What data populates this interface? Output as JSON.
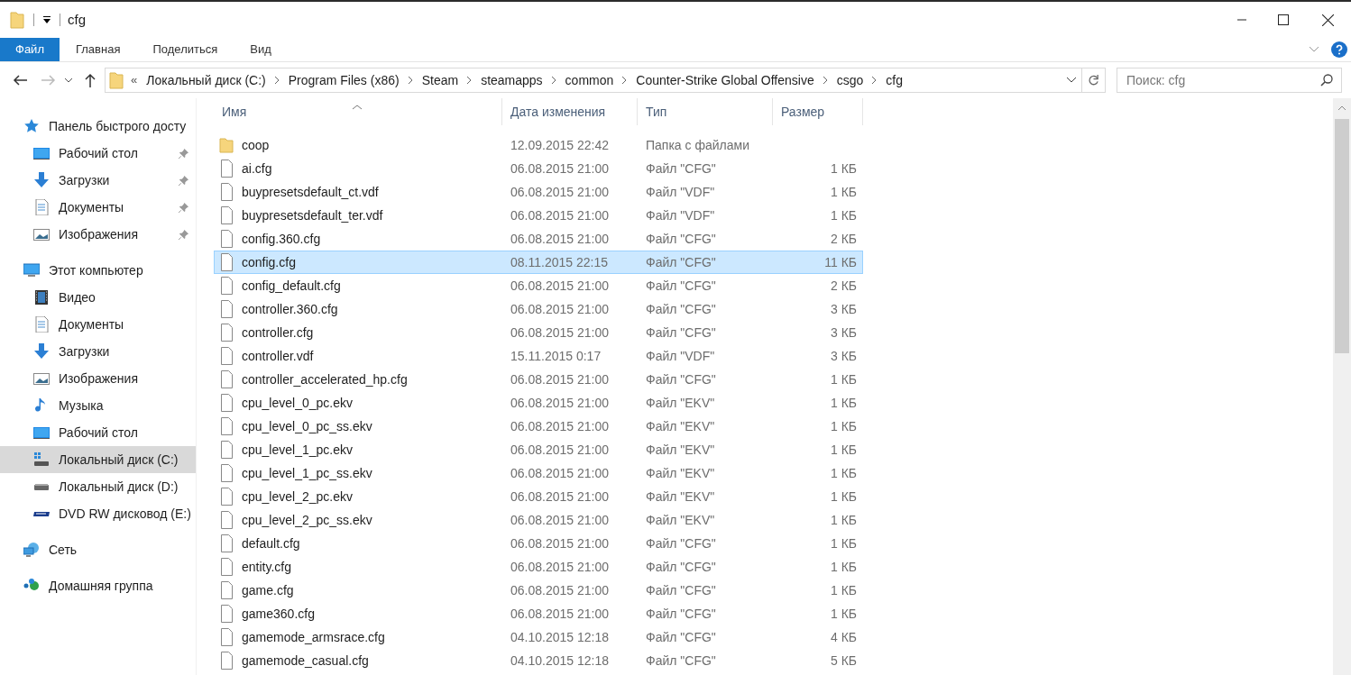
{
  "window": {
    "title": "cfg"
  },
  "ribbon_tabs": [
    {
      "label": "Файл",
      "selected": true
    },
    {
      "label": "Главная",
      "selected": false
    },
    {
      "label": "Поделиться",
      "selected": false
    },
    {
      "label": "Вид",
      "selected": false
    }
  ],
  "address_bar": {
    "overflow": "«",
    "path": [
      "Локальный диск (C:)",
      "Program Files (x86)",
      "Steam",
      "steamapps",
      "common",
      "Counter-Strike Global Offensive",
      "csgo",
      "cfg"
    ]
  },
  "search": {
    "placeholder": "Поиск: cfg"
  },
  "sidebar": {
    "items": [
      {
        "label": "Панель быстрого досту",
        "kind": "quick",
        "selected": false,
        "pinned": false,
        "children": [
          {
            "label": "Рабочий стол",
            "kind": "desktop",
            "selected": false,
            "pinned": true
          },
          {
            "label": "Загрузки",
            "kind": "downloads",
            "selected": false,
            "pinned": true
          },
          {
            "label": "Документы",
            "kind": "documents",
            "selected": false,
            "pinned": true
          },
          {
            "label": "Изображения",
            "kind": "pictures",
            "selected": false,
            "pinned": true
          }
        ]
      },
      {
        "label": "Этот компьютер",
        "kind": "computer",
        "selected": false,
        "pinned": false,
        "children": [
          {
            "label": "Видео",
            "kind": "video",
            "selected": false,
            "pinned": false
          },
          {
            "label": "Документы",
            "kind": "documents",
            "selected": false,
            "pinned": false
          },
          {
            "label": "Загрузки",
            "kind": "downloads",
            "selected": false,
            "pinned": false
          },
          {
            "label": "Изображения",
            "kind": "pictures",
            "selected": false,
            "pinned": false
          },
          {
            "label": "Музыка",
            "kind": "music",
            "selected": false,
            "pinned": false
          },
          {
            "label": "Рабочий стол",
            "kind": "desktop",
            "selected": false,
            "pinned": false
          },
          {
            "label": "Локальный диск (C:)",
            "kind": "system-drive",
            "selected": true,
            "pinned": false
          },
          {
            "label": "Локальный диск (D:)",
            "kind": "drive",
            "selected": false,
            "pinned": false
          },
          {
            "label": "DVD RW дисковод (E:)",
            "kind": "dvd",
            "selected": false,
            "pinned": false
          }
        ]
      },
      {
        "label": "Сеть",
        "kind": "network",
        "selected": false,
        "pinned": false
      },
      {
        "label": "Домашняя группа",
        "kind": "homegroup",
        "selected": false,
        "pinned": false
      }
    ]
  },
  "table": {
    "columns": [
      "Имя",
      "Дата изменения",
      "Тип",
      "Размер"
    ],
    "rows": [
      {
        "kind": "folder",
        "name": "coop",
        "date": "12.09.2015 22:42",
        "type": "Папка с файлами",
        "size": "",
        "selected": false
      },
      {
        "kind": "file",
        "name": "ai.cfg",
        "date": "06.08.2015 21:00",
        "type": "Файл \"CFG\"",
        "size": "1 КБ",
        "selected": false
      },
      {
        "kind": "file",
        "name": "buypresetsdefault_ct.vdf",
        "date": "06.08.2015 21:00",
        "type": "Файл \"VDF\"",
        "size": "1 КБ",
        "selected": false
      },
      {
        "kind": "file",
        "name": "buypresetsdefault_ter.vdf",
        "date": "06.08.2015 21:00",
        "type": "Файл \"VDF\"",
        "size": "1 КБ",
        "selected": false
      },
      {
        "kind": "file",
        "name": "config.360.cfg",
        "date": "06.08.2015 21:00",
        "type": "Файл \"CFG\"",
        "size": "2 КБ",
        "selected": false
      },
      {
        "kind": "file",
        "name": "config.cfg",
        "date": "08.11.2015 22:15",
        "type": "Файл \"CFG\"",
        "size": "11 КБ",
        "selected": true
      },
      {
        "kind": "file",
        "name": "config_default.cfg",
        "date": "06.08.2015 21:00",
        "type": "Файл \"CFG\"",
        "size": "2 КБ",
        "selected": false
      },
      {
        "kind": "file",
        "name": "controller.360.cfg",
        "date": "06.08.2015 21:00",
        "type": "Файл \"CFG\"",
        "size": "3 КБ",
        "selected": false
      },
      {
        "kind": "file",
        "name": "controller.cfg",
        "date": "06.08.2015 21:00",
        "type": "Файл \"CFG\"",
        "size": "3 КБ",
        "selected": false
      },
      {
        "kind": "file",
        "name": "controller.vdf",
        "date": "15.11.2015 0:17",
        "type": "Файл \"VDF\"",
        "size": "3 КБ",
        "selected": false
      },
      {
        "kind": "file",
        "name": "controller_accelerated_hp.cfg",
        "date": "06.08.2015 21:00",
        "type": "Файл \"CFG\"",
        "size": "1 КБ",
        "selected": false
      },
      {
        "kind": "file",
        "name": "cpu_level_0_pc.ekv",
        "date": "06.08.2015 21:00",
        "type": "Файл \"EKV\"",
        "size": "1 КБ",
        "selected": false
      },
      {
        "kind": "file",
        "name": "cpu_level_0_pc_ss.ekv",
        "date": "06.08.2015 21:00",
        "type": "Файл \"EKV\"",
        "size": "1 КБ",
        "selected": false
      },
      {
        "kind": "file",
        "name": "cpu_level_1_pc.ekv",
        "date": "06.08.2015 21:00",
        "type": "Файл \"EKV\"",
        "size": "1 КБ",
        "selected": false
      },
      {
        "kind": "file",
        "name": "cpu_level_1_pc_ss.ekv",
        "date": "06.08.2015 21:00",
        "type": "Файл \"EKV\"",
        "size": "1 КБ",
        "selected": false
      },
      {
        "kind": "file",
        "name": "cpu_level_2_pc.ekv",
        "date": "06.08.2015 21:00",
        "type": "Файл \"EKV\"",
        "size": "1 КБ",
        "selected": false
      },
      {
        "kind": "file",
        "name": "cpu_level_2_pc_ss.ekv",
        "date": "06.08.2015 21:00",
        "type": "Файл \"EKV\"",
        "size": "1 КБ",
        "selected": false
      },
      {
        "kind": "file",
        "name": "default.cfg",
        "date": "06.08.2015 21:00",
        "type": "Файл \"CFG\"",
        "size": "1 КБ",
        "selected": false
      },
      {
        "kind": "file",
        "name": "entity.cfg",
        "date": "06.08.2015 21:00",
        "type": "Файл \"CFG\"",
        "size": "1 КБ",
        "selected": false
      },
      {
        "kind": "file",
        "name": "game.cfg",
        "date": "06.08.2015 21:00",
        "type": "Файл \"CFG\"",
        "size": "1 КБ",
        "selected": false
      },
      {
        "kind": "file",
        "name": "game360.cfg",
        "date": "06.08.2015 21:00",
        "type": "Файл \"CFG\"",
        "size": "1 КБ",
        "selected": false
      },
      {
        "kind": "file",
        "name": "gamemode_armsrace.cfg",
        "date": "04.10.2015 12:18",
        "type": "Файл \"CFG\"",
        "size": "4 КБ",
        "selected": false
      },
      {
        "kind": "file",
        "name": "gamemode_casual.cfg",
        "date": "04.10.2015 12:18",
        "type": "Файл \"CFG\"",
        "size": "5 КБ",
        "selected": false
      }
    ]
  }
}
